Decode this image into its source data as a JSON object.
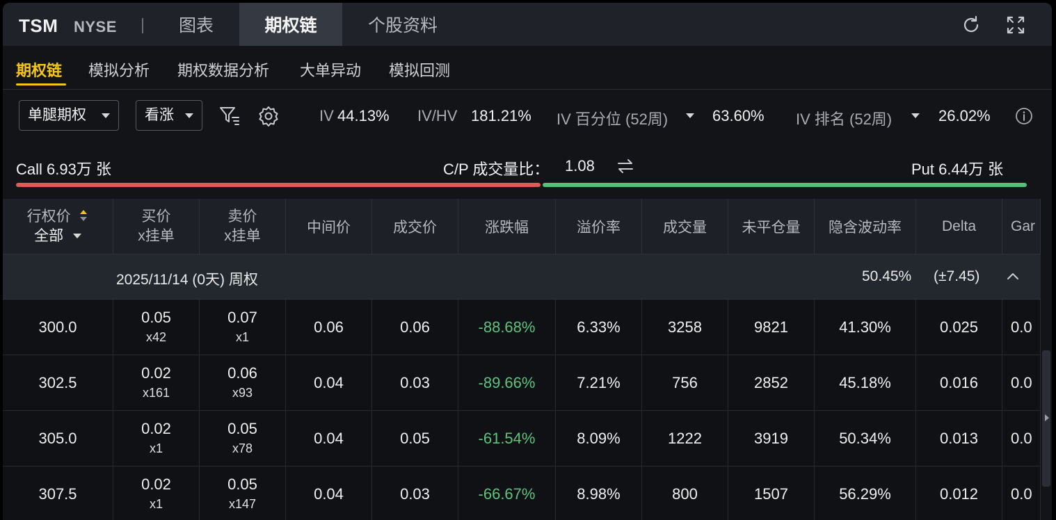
{
  "header": {
    "ticker": "TSM",
    "exchange": "NYSE",
    "tabs": [
      "图表",
      "期权链",
      "个股资料"
    ],
    "active_tab": "期权链"
  },
  "subtabs": [
    "期权链",
    "模拟分析",
    "期权数据分析",
    "大单异动",
    "模拟回测"
  ],
  "controls": {
    "strategy": "单腿期权",
    "direction": "看涨",
    "iv_label": "IV",
    "iv_value": "44.13%",
    "ivhv_label": "IV/HV",
    "ivhv_value": "181.21%",
    "iv_pct_label": "IV 百分位 (52周)",
    "iv_pct_value": "63.60%",
    "iv_rank_label": "IV 排名 (52周)",
    "iv_rank_value": "26.02%"
  },
  "volume": {
    "call": "Call 6.93万 张",
    "ratio_label": "C/P 成交量比：",
    "ratio_value": "1.08",
    "put": "Put 6.44万 张",
    "colors": {
      "call": "#e25a57",
      "put": "#55c07a"
    }
  },
  "table": {
    "headers": {
      "strike": "行权价",
      "strike_filter": "全部",
      "bid": "买价",
      "bid_sub": "x挂单",
      "ask": "卖价",
      "ask_sub": "x挂单",
      "mid": "中间价",
      "last": "成交价",
      "change": "涨跌幅",
      "premium": "溢价率",
      "volume": "成交量",
      "oi": "未平仓量",
      "iv": "隐含波动率",
      "delta": "Delta",
      "gamma": "Gar"
    },
    "expiry": {
      "label": "2025/11/14 (0天) 周权",
      "iv": "50.45%",
      "move": "(±7.45)"
    },
    "rows": [
      {
        "strike": "300.0",
        "bid": "0.05",
        "bid_size": "x42",
        "ask": "0.07",
        "ask_size": "x1",
        "mid": "0.06",
        "last": "0.06",
        "change": "-88.68%",
        "premium": "6.33%",
        "volume": "3258",
        "oi": "9821",
        "iv": "41.30%",
        "delta": "0.025",
        "gamma": "0.0"
      },
      {
        "strike": "302.5",
        "bid": "0.02",
        "bid_size": "x161",
        "ask": "0.06",
        "ask_size": "x93",
        "mid": "0.04",
        "last": "0.03",
        "change": "-89.66%",
        "premium": "7.21%",
        "volume": "756",
        "oi": "2852",
        "iv": "45.18%",
        "delta": "0.016",
        "gamma": "0.0"
      },
      {
        "strike": "305.0",
        "bid": "0.02",
        "bid_size": "x1",
        "ask": "0.05",
        "ask_size": "x78",
        "mid": "0.04",
        "last": "0.05",
        "change": "-61.54%",
        "premium": "8.09%",
        "volume": "1222",
        "oi": "3919",
        "iv": "50.34%",
        "delta": "0.013",
        "gamma": "0.0"
      },
      {
        "strike": "307.5",
        "bid": "0.02",
        "bid_size": "x1",
        "ask": "0.05",
        "ask_size": "x147",
        "mid": "0.04",
        "last": "0.03",
        "change": "-66.67%",
        "premium": "8.98%",
        "volume": "800",
        "oi": "1507",
        "iv": "56.29%",
        "delta": "0.012",
        "gamma": "0.0"
      }
    ]
  }
}
